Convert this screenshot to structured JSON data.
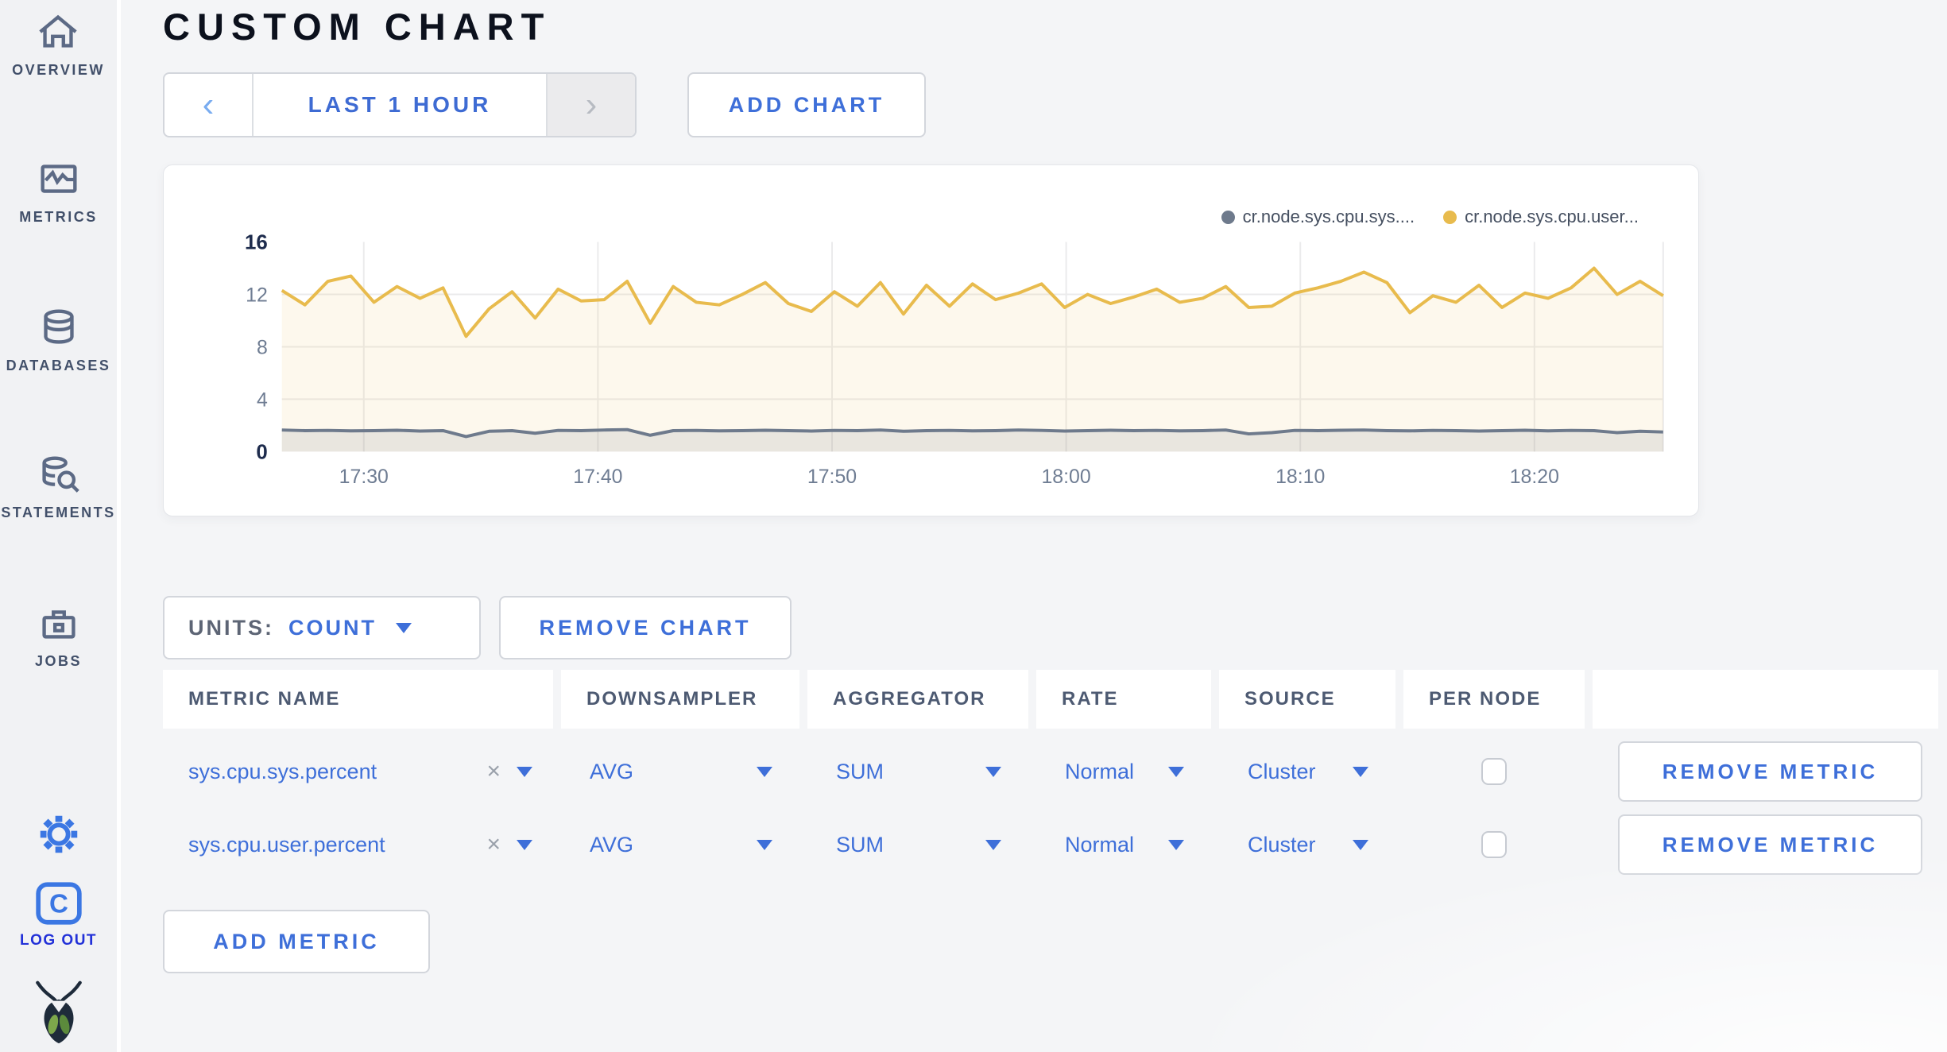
{
  "page": {
    "title": "CUSTOM CHART"
  },
  "sidebar": {
    "items": [
      {
        "label": "OVERVIEW",
        "icon": "home-icon"
      },
      {
        "label": "METRICS",
        "icon": "metrics-icon"
      },
      {
        "label": "DATABASES",
        "icon": "database-icon"
      },
      {
        "label": "STATEMENTS",
        "icon": "statements-icon"
      },
      {
        "label": "JOBS",
        "icon": "jobs-icon"
      }
    ],
    "settings_icon": "gear-icon",
    "logout": {
      "label": "LOG OUT",
      "logo_letter": "C"
    },
    "brand_icon": "cockroach-logo"
  },
  "toolbar": {
    "prev_arrow": "‹",
    "time_range_label": "LAST 1 HOUR",
    "next_arrow": "›",
    "add_chart_label": "ADD CHART"
  },
  "chart_controls": {
    "units_label": "UNITS:",
    "units_value": "COUNT",
    "remove_chart_label": "REMOVE CHART"
  },
  "chart_data": {
    "type": "line",
    "title": "",
    "xlabel": "",
    "ylabel": "",
    "ylim": [
      0,
      16
    ],
    "y_ticks": [
      0,
      4,
      8,
      12,
      16
    ],
    "x_tick_labels": [
      "17:30",
      "17:40",
      "17:50",
      "18:00",
      "18:10",
      "18:20"
    ],
    "x_tick_fractions": [
      0.0593,
      0.2288,
      0.3983,
      0.5678,
      0.7373,
      0.9068
    ],
    "grid": true,
    "legend_position": "top-right",
    "series": [
      {
        "name": "cr.node.sys.cpu.sys....",
        "color": "#6e7a8c",
        "fill": "rgba(110,122,140,0.14)",
        "values": [
          1.65,
          1.6,
          1.62,
          1.58,
          1.6,
          1.63,
          1.57,
          1.6,
          1.15,
          1.55,
          1.6,
          1.4,
          1.62,
          1.6,
          1.65,
          1.68,
          1.25,
          1.6,
          1.62,
          1.58,
          1.6,
          1.63,
          1.6,
          1.57,
          1.62,
          1.6,
          1.65,
          1.55,
          1.6,
          1.62,
          1.58,
          1.6,
          1.65,
          1.62,
          1.57,
          1.6,
          1.63,
          1.6,
          1.62,
          1.58,
          1.6,
          1.65,
          1.35,
          1.45,
          1.62,
          1.6,
          1.63,
          1.65,
          1.6,
          1.58,
          1.62,
          1.6,
          1.57,
          1.6,
          1.63,
          1.58,
          1.62,
          1.6,
          1.45,
          1.55,
          1.5
        ]
      },
      {
        "name": "cr.node.sys.cpu.user...",
        "color": "#e8bb4d",
        "fill": "rgba(232,187,77,0.10)",
        "values": [
          12.3,
          11.2,
          13.0,
          13.4,
          11.4,
          12.6,
          11.7,
          12.5,
          8.8,
          10.9,
          12.2,
          10.2,
          12.4,
          11.5,
          11.6,
          13.0,
          9.8,
          12.6,
          11.4,
          11.2,
          12.0,
          12.9,
          11.3,
          10.7,
          12.2,
          11.1,
          12.9,
          10.5,
          12.7,
          11.1,
          12.8,
          11.6,
          12.1,
          12.8,
          11.0,
          12.0,
          11.3,
          11.8,
          12.4,
          11.4,
          11.7,
          12.6,
          11.0,
          11.1,
          12.1,
          12.5,
          13.0,
          13.7,
          12.9,
          10.6,
          11.9,
          11.4,
          12.7,
          11.0,
          12.1,
          11.7,
          12.5,
          14.0,
          12.0,
          13.0,
          11.9
        ]
      }
    ]
  },
  "metrics_table": {
    "headers": [
      "METRIC NAME",
      "DOWNSAMPLER",
      "AGGREGATOR",
      "RATE",
      "SOURCE",
      "PER NODE",
      ""
    ],
    "clear_symbol": "×",
    "rows": [
      {
        "metric": "sys.cpu.sys.percent",
        "downsampler": "AVG",
        "aggregator": "SUM",
        "rate": "Normal",
        "source": "Cluster",
        "per_node_checked": false,
        "remove_label": "REMOVE METRIC"
      },
      {
        "metric": "sys.cpu.user.percent",
        "downsampler": "AVG",
        "aggregator": "SUM",
        "rate": "Normal",
        "source": "Cluster",
        "per_node_checked": false,
        "remove_label": "REMOVE METRIC"
      }
    ],
    "add_metric_label": "ADD METRIC"
  },
  "colors": {
    "accent_blue": "#3e6fd9",
    "logout_blue": "#2231d8",
    "icon_slate": "#5c6a85",
    "page_bg": "#f4f5f7",
    "series_sys": "#6e7a8c",
    "series_user": "#e8bb4d"
  }
}
